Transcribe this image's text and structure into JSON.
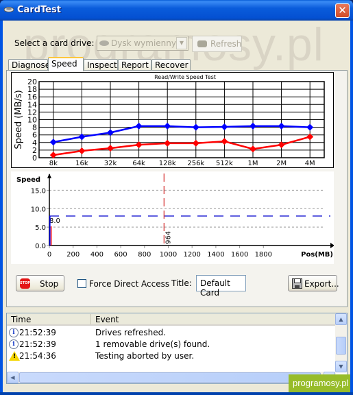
{
  "window": {
    "title": "CardTest",
    "close_label": "✕"
  },
  "watermark": "programosy.pl",
  "drive": {
    "label": "Select a card drive:",
    "selected": "Dysk wymienny (",
    "dropdown_glyph": "▼",
    "refresh_label": "Refresh"
  },
  "tabs": [
    {
      "label": "Diagnose",
      "active": false
    },
    {
      "label": "Speed",
      "active": true
    },
    {
      "label": "Inspect",
      "active": false
    },
    {
      "label": "Report",
      "active": false
    },
    {
      "label": "Recover",
      "active": false
    }
  ],
  "controls": {
    "stop_label": "Stop",
    "stop_icon_text": "STOP",
    "force_direct_label": "Force Direct Access",
    "force_direct_checked": false,
    "title_label": "Title:",
    "title_value": "Default Card",
    "export_label": "Export..."
  },
  "log": {
    "columns": [
      "Time",
      "Event"
    ],
    "rows": [
      {
        "icon": "info",
        "time": "21:52:39",
        "event": "Drives refreshed."
      },
      {
        "icon": "info",
        "time": "21:52:39",
        "event": "1 removable drive(s) found."
      },
      {
        "icon": "warning",
        "time": "21:54:36",
        "event": "Testing aborted by user."
      }
    ]
  },
  "badge": "programosy.pl",
  "colors": {
    "read_series": "#0000ff",
    "write_series": "#ff0000",
    "titlebar": "#0054e3",
    "badge": "#97bc2a"
  },
  "chart_data": [
    {
      "type": "line",
      "title": "Read/Write Speed Test",
      "xlabel": "",
      "ylabel": "Speed (MB/s)",
      "categories": [
        "8k",
        "16k",
        "32k",
        "64k",
        "128k",
        "256k",
        "512k",
        "1M",
        "2M",
        "4M"
      ],
      "ylim": [
        0,
        20
      ],
      "yticks": [
        "0",
        "2",
        "4",
        "6",
        "8",
        "10",
        "12",
        "14",
        "16",
        "18",
        "20"
      ],
      "grid": true,
      "series": [
        {
          "name": "read",
          "color": "#0000ff",
          "values": [
            4.1,
            5.5,
            6.6,
            8.3,
            8.3,
            8.0,
            8.1,
            8.3,
            8.3,
            8.0
          ]
        },
        {
          "name": "write",
          "color": "#ff0000",
          "values": [
            0.7,
            1.8,
            2.5,
            3.4,
            3.8,
            3.8,
            4.3,
            2.3,
            3.4,
            5.5
          ]
        }
      ]
    },
    {
      "type": "line",
      "title": "",
      "xlabel": "Pos(MB)",
      "ylabel": "Speed",
      "xlim": [
        0,
        2000
      ],
      "ylim": [
        0,
        17.5
      ],
      "xticks": [
        "0",
        "200",
        "400",
        "600",
        "800",
        "1000",
        "1200",
        "1400",
        "1600",
        "1800"
      ],
      "yticks": [
        "0.0",
        "5.0",
        "10.0",
        "15.0"
      ],
      "grid": "dashed-horizontal",
      "average_line": {
        "value": 8.0,
        "label": "8.0",
        "color": "#0000cc"
      },
      "marker_line": {
        "x": 964,
        "label": "964",
        "color": "#cc0000"
      },
      "series": [
        {
          "name": "read",
          "color": "#0000ff",
          "points": [
            [
              5,
              8.0
            ],
            [
              5,
              0
            ]
          ]
        },
        {
          "name": "write",
          "color": "#ff0000",
          "points": [
            [
              15,
              5.2
            ],
            [
              15,
              0
            ]
          ]
        }
      ]
    }
  ]
}
